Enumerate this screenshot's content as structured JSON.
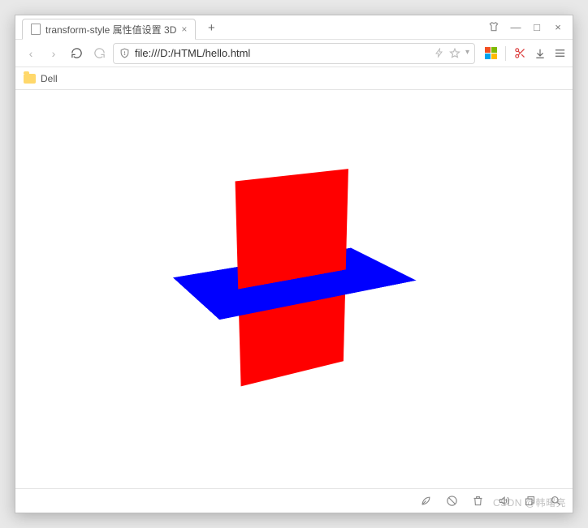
{
  "window": {
    "tab_title": "transform-style 属性值设置 3D",
    "minimize": "—",
    "maximize": "□",
    "close": "×",
    "new_tab": "+"
  },
  "toolbar": {
    "url": "file:///D:/HTML/hello.html",
    "back": "‹",
    "forward": "›"
  },
  "bookmarks": {
    "item1": "Dell"
  },
  "statusbar": {
    "rocket": "rocket-icon",
    "adblock": "adblock-icon",
    "trash": "trash-icon",
    "sound": "sound-icon",
    "restore": "restore-icon",
    "search": "search-icon"
  },
  "watermark": "CSDN @韩曙亮",
  "colors": {
    "red": "#ff0000",
    "blue": "#0000ff"
  }
}
